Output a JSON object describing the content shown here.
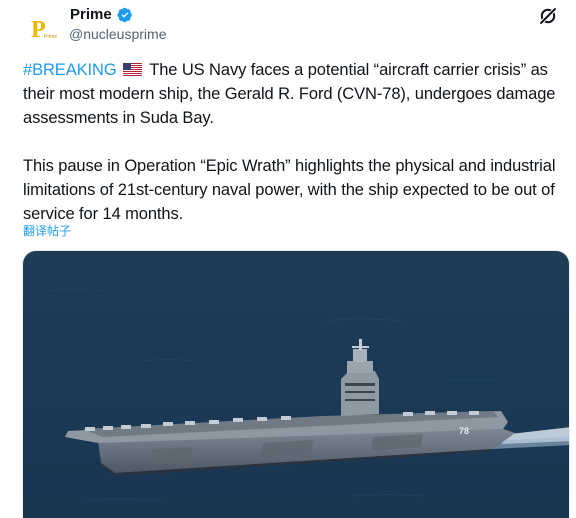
{
  "author": {
    "display_name": "Prime",
    "handle": "@nucleusprime",
    "avatar_letter": "P",
    "avatar_caption": "Prime",
    "verified": true
  },
  "post": {
    "hashtag": "#BREAKING",
    "flag_icon": "us-flag-icon",
    "paragraph1_rest": " The US Navy faces a potential “aircraft carrier crisis” as their most modern ship, the Gerald R. Ford (CVN-78), undergoes damage assessments in Suda Bay.",
    "paragraph2": "This pause in Operation “Epic Wrath” highlights the physical and industrial limitations of 21st-century naval power, with the ship expected to be out of service for 14 months.",
    "translate_label": "翻译帖子"
  },
  "media": {
    "hull_number": "78"
  },
  "colors": {
    "accent": "#1d9bf0",
    "text": "#0f1419",
    "muted": "#536471",
    "avatar_yellow": "#f4b400"
  }
}
